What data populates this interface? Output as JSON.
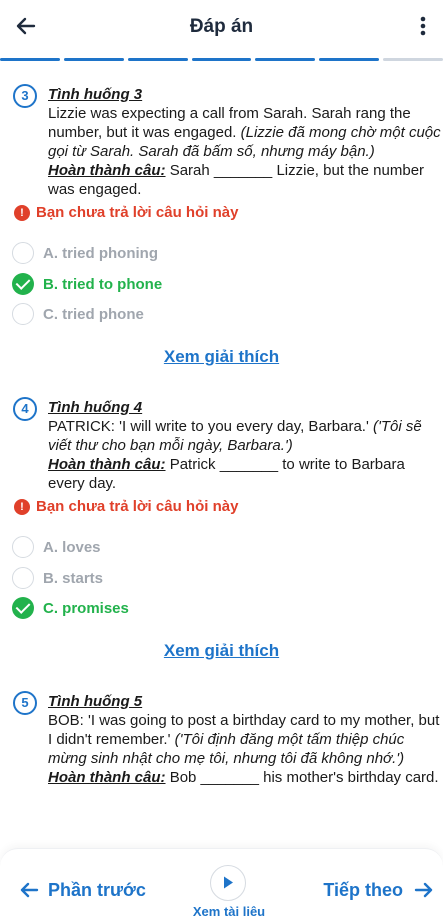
{
  "header": {
    "title": "Đáp án"
  },
  "progress": {
    "segments_done": 6,
    "segments_total": 7
  },
  "questions": [
    {
      "number": "3",
      "title": "Tình huống 3",
      "body_en": "Lizzie was expecting a call from Sarah. Sarah rang the number, but it was engaged.",
      "body_vi": "(Lizzie đã mong chờ một cuộc gọi từ Sarah. Sarah đã bấm số, nhưng máy bận.)",
      "complete_label": "Hoàn thành câu:",
      "complete_text": "Sarah _______ Lizzie, but the number was engaged.",
      "warning": "Bạn chưa trả lời câu hỏi này",
      "options": [
        {
          "label": "A. tried phoning",
          "correct": false
        },
        {
          "label": "B. tried to phone",
          "correct": true
        },
        {
          "label": "C. tried phone",
          "correct": false
        }
      ],
      "explain": "Xem giải thích"
    },
    {
      "number": "4",
      "title": "Tình huống 4",
      "body_en": "PATRICK: 'I will write to you every day, Barbara.'",
      "body_vi": "('Tôi sẽ viết thư cho bạn mỗi ngày, Barbara.')",
      "complete_label": "Hoàn thành câu:",
      "complete_text": "Patrick _______ to write to Barbara every day.",
      "warning": "Bạn chưa trả lời câu hỏi này",
      "options": [
        {
          "label": "A. loves",
          "correct": false
        },
        {
          "label": "B. starts",
          "correct": false
        },
        {
          "label": "C. promises",
          "correct": true
        }
      ],
      "explain": "Xem giải thích"
    },
    {
      "number": "5",
      "title": "Tình huống 5",
      "body_en": "BOB: 'I was going to post a birthday card to my mother, but I didn't remember.'",
      "body_vi": "('Tôi định đăng một tấm thiệp chúc mừng sinh nhật cho mẹ tôi, nhưng tôi đã không nhớ.')",
      "complete_label": "Hoàn thành câu:",
      "complete_text": "Bob _______ his mother's birthday card."
    }
  ],
  "footer": {
    "prev_label": "Phần trước",
    "next_label": "Tiếp theo",
    "play_label": "Xem tài liệu"
  },
  "colors": {
    "accent": "#1e74c9",
    "correct": "#22b24c",
    "warning": "#e0402a",
    "muted": "#a0a6ae"
  },
  "icons": [
    "arrow-left-icon",
    "more-vertical-icon",
    "warning-icon",
    "check-icon",
    "play-icon",
    "arrow-right-icon"
  ]
}
